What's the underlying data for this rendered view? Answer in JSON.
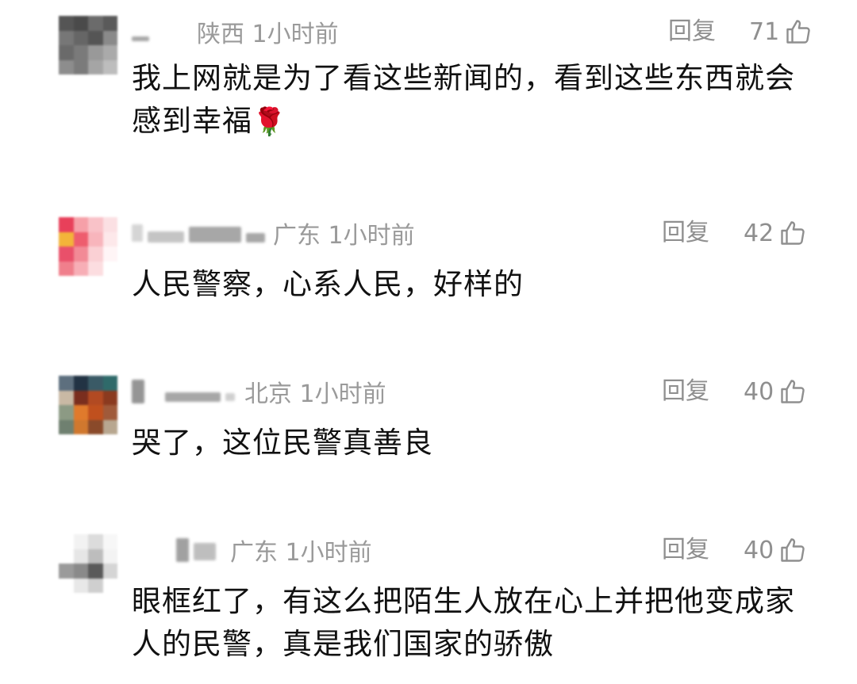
{
  "reply_label": "回复",
  "comments": [
    {
      "region_time": "陕西 1小时前",
      "likes": "71",
      "text": "我上网就是为了看这些新闻的，看到这些东西就会感到幸福",
      "emoji": "🌹",
      "avatar_icon": "blurred-avatar-icon",
      "avatar_colors": [
        "#555",
        "#4a4a4a",
        "#6b6b6b",
        "#5a5a5a",
        "#777",
        "#666",
        "#555",
        "#8a8a8a",
        "#6a6a6a",
        "#7a7a7a",
        "#999",
        "#aaa",
        "#8d8d8d",
        "#7b7b7b",
        "#a5a5a5",
        "#bdbdbd"
      ]
    },
    {
      "region_time": "广东 1小时前",
      "likes": "42",
      "text": "人民警察，心系人民，好样的",
      "avatar_icon": "blurred-avatar-icon",
      "avatar_colors": [
        "#e8405a",
        "#f6a0a8",
        "#f9c2c8",
        "#fbe0e3",
        "#f3b43a",
        "#ee5d6e",
        "#f8b5bc",
        "#fde8ea",
        "#e9506a",
        "#f28a96",
        "#fad0d4",
        "#fff5f6",
        "#f07f8c",
        "#f7aeb6",
        "#fcdde0",
        "#ffffff"
      ]
    },
    {
      "region_time": "北京 1小时前",
      "likes": "40",
      "text": "哭了，这位民警真善良",
      "avatar_icon": "blurred-avatar-icon",
      "avatar_colors": [
        "#5d6f7e",
        "#223344",
        "#3a5a66",
        "#2f6a6a",
        "#c9b9a4",
        "#7a2e1e",
        "#b24a22",
        "#8b3a1f",
        "#8c9a84",
        "#e07a2c",
        "#c0501e",
        "#a05a3a",
        "#6f8070",
        "#d0782e",
        "#8a4a2a",
        "#b8a790"
      ]
    },
    {
      "region_time": "广东 1小时前",
      "likes": "40",
      "text": "眼框红了，有这么把陌生人放在心上并把他变成家人的民警，真是我们国家的骄傲",
      "avatar_icon": "blurred-avatar-icon",
      "avatar_colors": [
        "#ffffff",
        "#f2f2f2",
        "#dcdcdc",
        "#f7f7f7",
        "#ffffff",
        "#e6e6e6",
        "#bdbdbd",
        "#f3f3f3",
        "#9a9a9a",
        "#8a8a8a",
        "#5a5a5a",
        "#d5d5d5",
        "#ffffff",
        "#e8e8e8",
        "#cfcfcf",
        "#ffffff"
      ]
    }
  ]
}
